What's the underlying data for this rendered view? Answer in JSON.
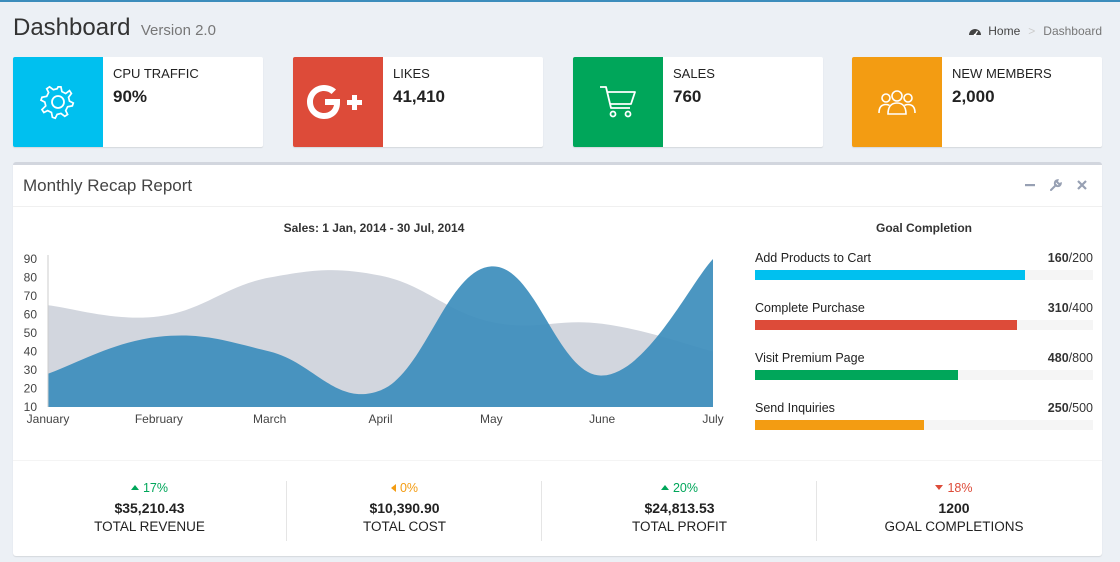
{
  "header": {
    "title": "Dashboard",
    "subtitle": "Version 2.0",
    "breadcrumb": {
      "home": "Home",
      "current": "Dashboard"
    }
  },
  "info_boxes": [
    {
      "label": "CPU TRAFFIC",
      "value": "90%",
      "color": "#00c0ef",
      "icon": "gear-icon"
    },
    {
      "label": "LIKES",
      "value": "41,410",
      "color": "#dd4b39",
      "icon": "google-plus-icon"
    },
    {
      "label": "SALES",
      "value": "760",
      "color": "#00a65a",
      "icon": "shopping-cart-icon"
    },
    {
      "label": "NEW MEMBERS",
      "value": "2,000",
      "color": "#f39c12",
      "icon": "users-icon"
    }
  ],
  "report": {
    "title": "Monthly Recap Report",
    "tools": [
      "minus-icon",
      "wrench-icon",
      "close-icon"
    ],
    "chart_title": "Sales: 1 Jan, 2014 - 30 Jul, 2014",
    "goal_title": "Goal Completion",
    "goals": [
      {
        "label": "Add Products to Cart",
        "current": "160",
        "total": "/200",
        "fraction": 0.8,
        "color": "#00c0ef"
      },
      {
        "label": "Complete Purchase",
        "current": "310",
        "total": "/400",
        "fraction": 0.775,
        "color": "#dd4b39"
      },
      {
        "label": "Visit Premium Page",
        "current": "480",
        "total": "/800",
        "fraction": 0.6,
        "color": "#00a65a"
      },
      {
        "label": "Send Inquiries",
        "current": "250",
        "total": "/500",
        "fraction": 0.5,
        "color": "#f39c12"
      }
    ]
  },
  "chart_data": {
    "type": "area",
    "title": "Sales: 1 Jan, 2014 - 30 Jul, 2014",
    "xlabel": "",
    "ylabel": "",
    "categories": [
      "January",
      "February",
      "March",
      "April",
      "May",
      "June",
      "July"
    ],
    "series": [
      {
        "values": [
          65,
          59,
          80,
          81,
          56,
          55,
          40
        ],
        "color": "#d2d6de"
      },
      {
        "values": [
          28,
          48,
          40,
          19,
          86,
          27,
          90
        ],
        "color": "#3c8dbc"
      }
    ],
    "ylim": [
      10,
      90
    ],
    "yticks": [
      10,
      20,
      30,
      40,
      50,
      60,
      70,
      80,
      90
    ],
    "grid": false,
    "legend": "none"
  },
  "footer": [
    {
      "percent": "17%",
      "direction": "up",
      "color": "#00a65a",
      "amount": "$35,210.43",
      "label": "TOTAL REVENUE"
    },
    {
      "percent": "0%",
      "direction": "left",
      "color": "#f39c12",
      "amount": "$10,390.90",
      "label": "TOTAL COST"
    },
    {
      "percent": "20%",
      "direction": "up",
      "color": "#00a65a",
      "amount": "$24,813.53",
      "label": "TOTAL PROFIT"
    },
    {
      "percent": "18%",
      "direction": "down",
      "color": "#dd4b39",
      "amount": "1200",
      "label": "GOAL COMPLETIONS"
    }
  ]
}
